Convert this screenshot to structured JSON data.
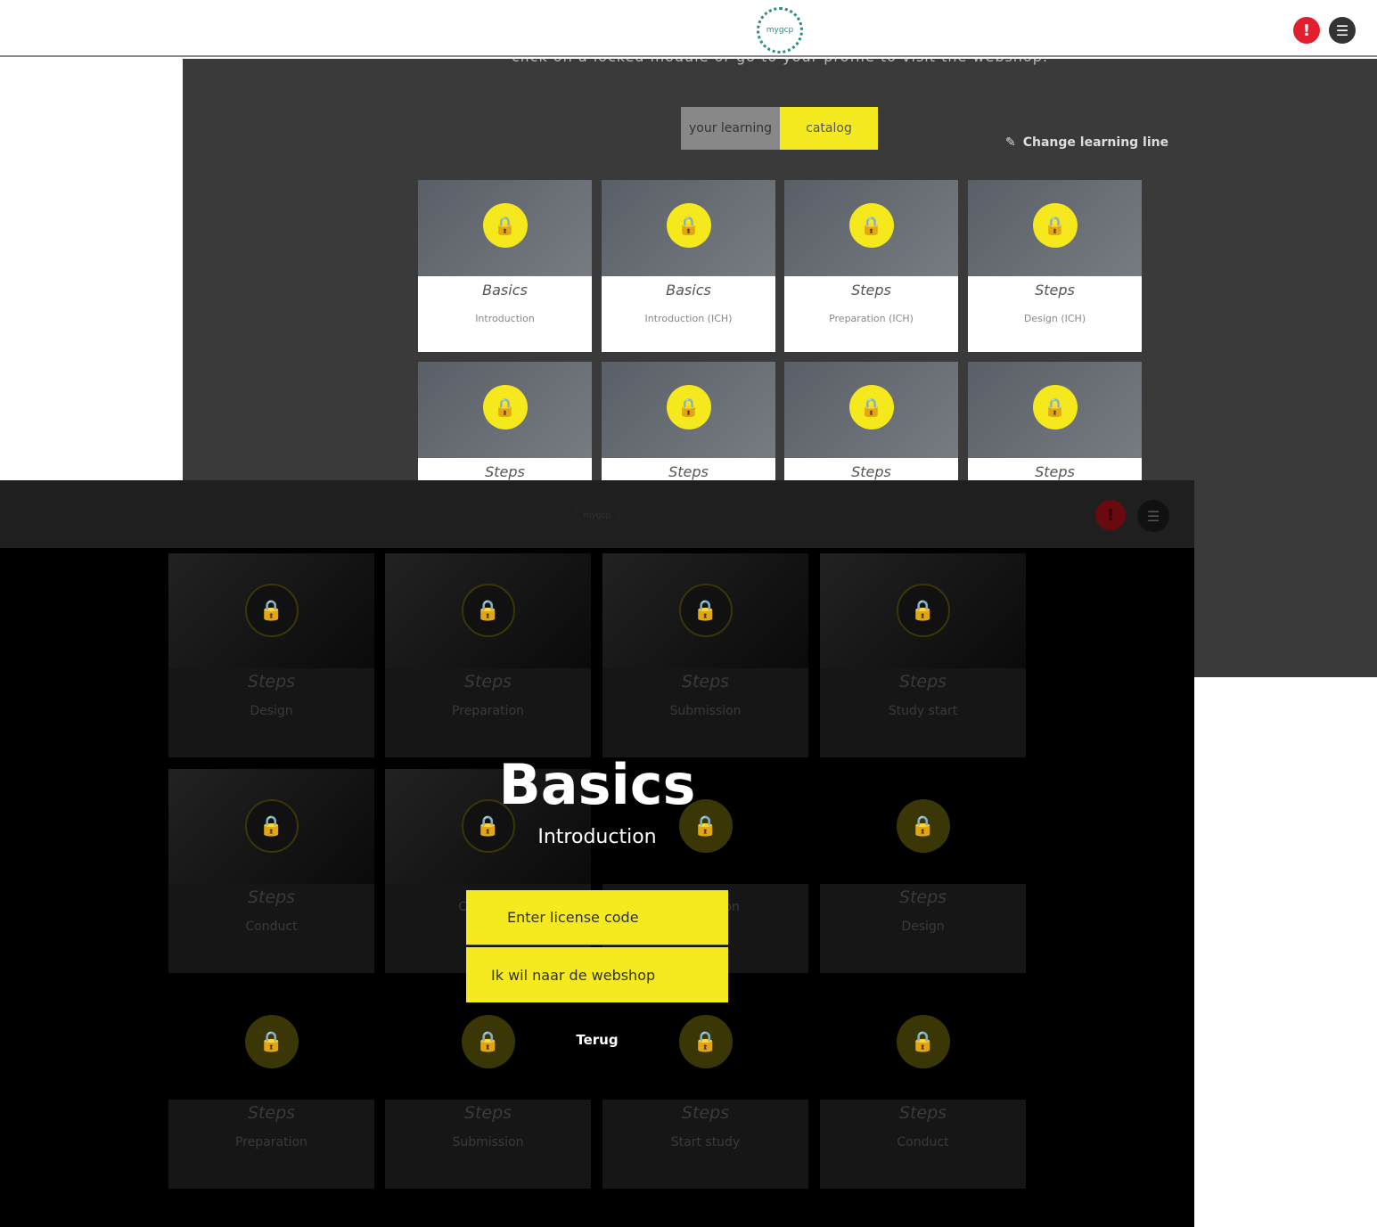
{
  "top": {
    "logo_text": "mygcp",
    "intro_text": "click on a locked module or go to your profile to visit the webshop.",
    "tabs": [
      {
        "label": "your learning"
      },
      {
        "label": "catalog"
      }
    ],
    "change_learning_line": "Change learning line",
    "cards": [
      {
        "title": "Basics",
        "subtitle": "Introduction"
      },
      {
        "title": "Basics",
        "subtitle": "Introduction (ICH)"
      },
      {
        "title": "Steps",
        "subtitle": "Preparation (ICH)"
      },
      {
        "title": "Steps",
        "subtitle": "Design (ICH)"
      },
      {
        "title": "Steps",
        "subtitle": ""
      },
      {
        "title": "Steps",
        "subtitle": ""
      },
      {
        "title": "Steps",
        "subtitle": ""
      },
      {
        "title": "Steps",
        "subtitle": ""
      }
    ]
  },
  "bottom": {
    "logo_text": "mygcp",
    "cards": [
      {
        "title": "Steps",
        "subtitle": "Design"
      },
      {
        "title": "Steps",
        "subtitle": "Preparation"
      },
      {
        "title": "Steps",
        "subtitle": "Submission"
      },
      {
        "title": "Steps",
        "subtitle": "Study start"
      },
      {
        "title": "Steps",
        "subtitle": "Conduct"
      },
      {
        "title": "",
        "subtitle": "Close-out"
      },
      {
        "title": "",
        "subtitle": "Publication"
      },
      {
        "title": "Steps",
        "subtitle": "Design"
      },
      {
        "title": "Steps",
        "subtitle": "Preparation"
      },
      {
        "title": "Steps",
        "subtitle": "Submission"
      },
      {
        "title": "Steps",
        "subtitle": "Start study"
      },
      {
        "title": "Steps",
        "subtitle": "Conduct"
      }
    ],
    "modal": {
      "title": "Basics",
      "subtitle": "Introduction",
      "license_button": "Enter license code",
      "webshop_button": "Ik wil naar de webshop",
      "back_link": "Terug"
    }
  },
  "colors": {
    "accent": "#f5ea1f",
    "alert": "#e0202f",
    "brand": "#2a8c84"
  }
}
